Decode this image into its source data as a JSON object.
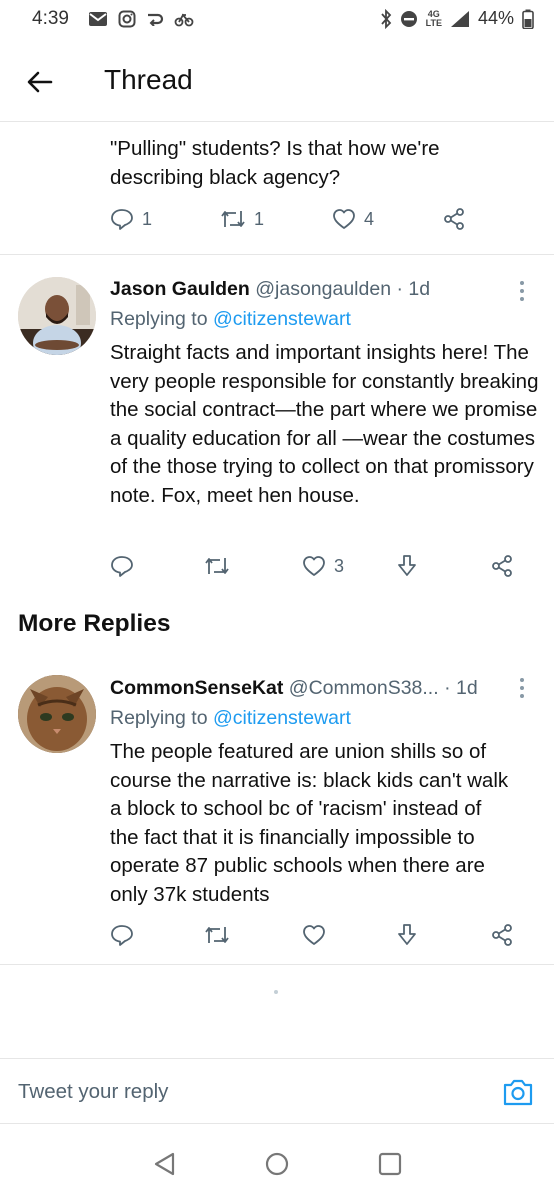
{
  "status_bar": {
    "time": "4:39",
    "network": "4G",
    "network_sub": "LTE",
    "battery": "44%"
  },
  "header": {
    "title": "Thread"
  },
  "tweets": [
    {
      "text": "\"Pulling\" students? Is that how we're describing black agency?",
      "reply_count": "1",
      "retweet_count": "1",
      "like_count": "4"
    },
    {
      "author_name": "Jason Gaulden",
      "author_meta": "@jasongaulden · 1d",
      "replying_prefix": "Replying to",
      "replying_handle": "@citizenstewart",
      "text": "Straight facts and important insights here! The very people responsible for constantly breaking the social contract—the part where we promise a quality education for all —wear the costumes of the those trying to collect on that promissory note. Fox, meet hen house.",
      "reply_count": "",
      "retweet_count": "",
      "like_count": "3"
    },
    {
      "author_name": "CommonSenseKat",
      "author_meta": "@CommonS38... · 1d",
      "replying_prefix": "Replying to",
      "replying_handle": "@citizenstewart",
      "text": "The people featured are union shills so of course the narrative is: black kids can't walk a block to school bc of 'racism' instead of the fact that it is financially impossible to operate 87 public schools when there are only 37k students",
      "reply_count": "",
      "retweet_count": "",
      "like_count": ""
    }
  ],
  "section": {
    "more_replies": "More Replies"
  },
  "composer": {
    "placeholder": "Tweet your reply"
  },
  "icons": {
    "reply": "reply-icon",
    "retweet": "retweet-icon",
    "like": "heart-icon",
    "share": "share-icon",
    "download": "download-icon",
    "camera": "camera-icon"
  },
  "colors": {
    "link": "#1d9bf0",
    "muted": "#536471",
    "text": "#111111"
  }
}
